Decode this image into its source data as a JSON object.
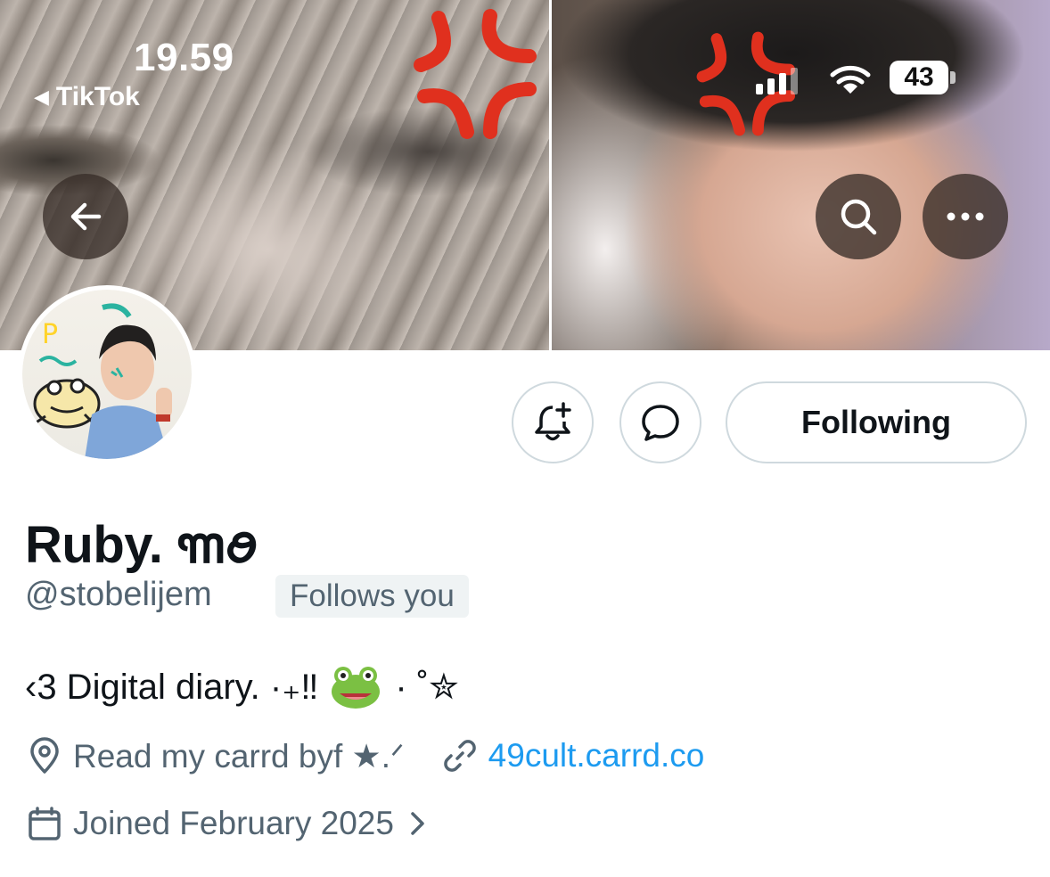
{
  "status_bar": {
    "time": "19.59",
    "back_app": "TikTok",
    "battery": "43"
  },
  "banner": {
    "icons": [
      "anger-symbol-icon",
      "anger-symbol-icon"
    ]
  },
  "header_buttons": {
    "back": "back-arrow-icon",
    "search": "search-icon",
    "more": "more-icon"
  },
  "actions": {
    "notify_icon": "bell-plus-icon",
    "message_icon": "message-icon",
    "following_label": "Following"
  },
  "profile": {
    "display_name": "Ruby. ꧑ꪮ",
    "handle": "@stobelijem",
    "follows_you": "Follows you",
    "bio_prefix": "‹3 Digital diary. ·₊‼",
    "bio_suffix": "· ˚✮",
    "location": "Read my carrd byf ★.ᐟ",
    "link": "49cult.carrd.co",
    "joined": "Joined February 2025"
  },
  "colors": {
    "link": "#1d9bf0",
    "secondary_text": "#536471",
    "primary_text": "#0f1419",
    "badge_bg": "#eff3f4",
    "anger_red": "#e0301e"
  }
}
